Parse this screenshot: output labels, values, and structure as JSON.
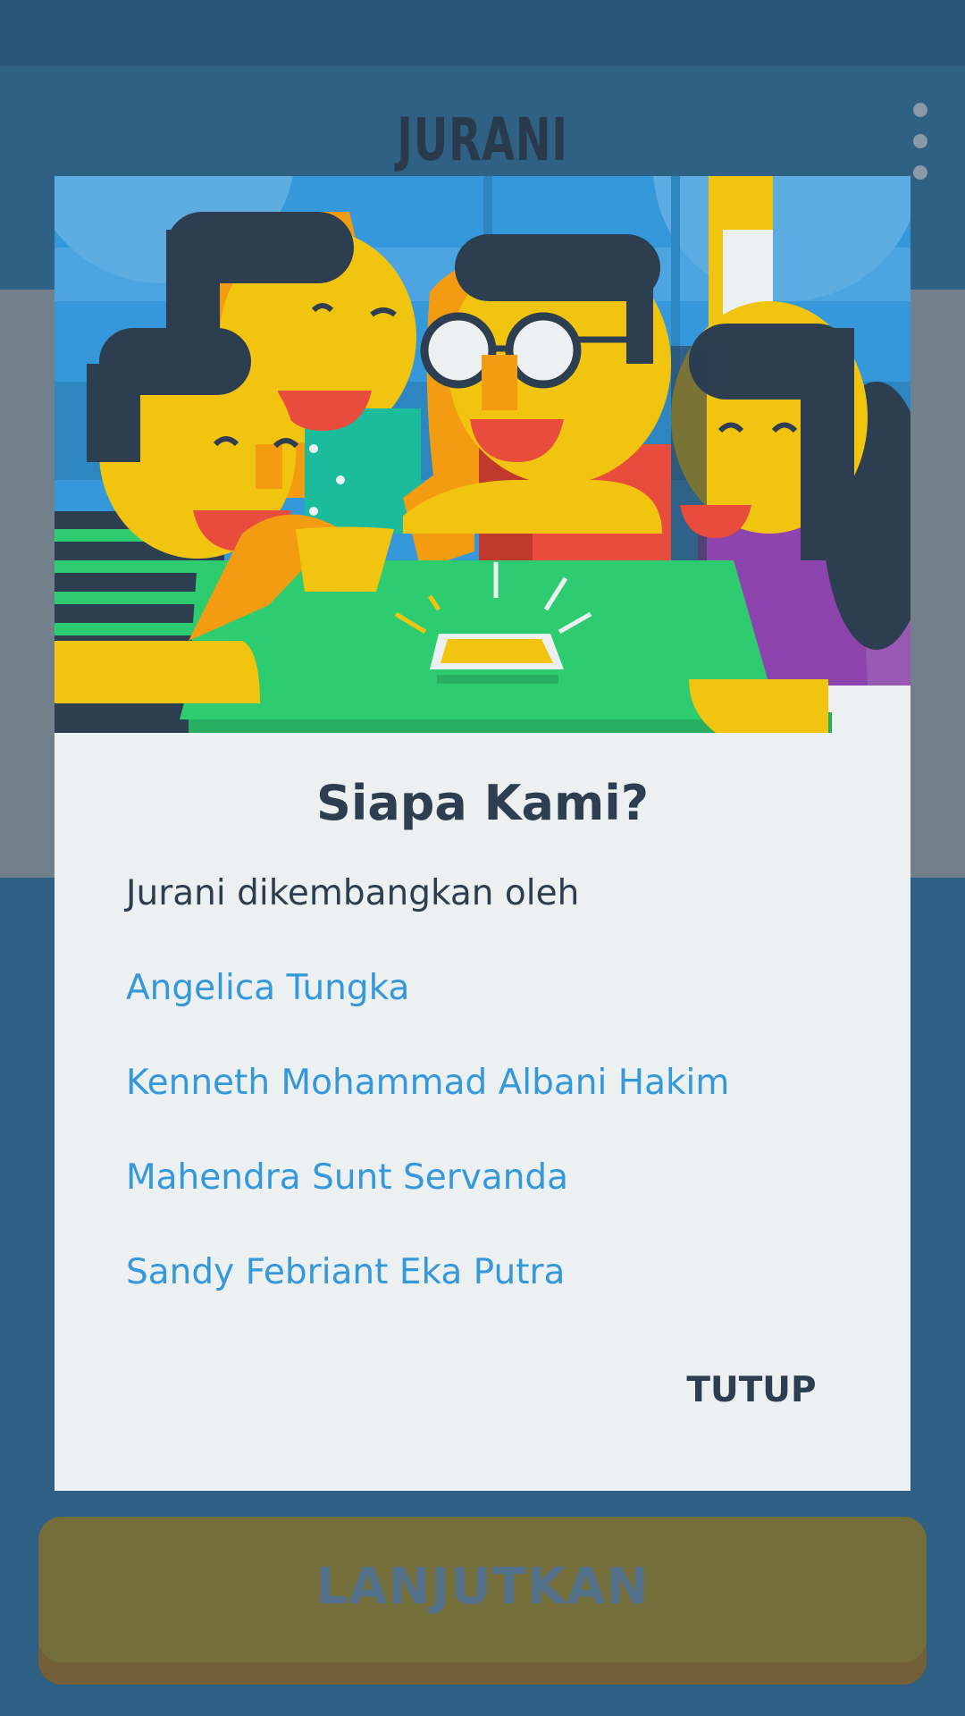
{
  "app": {
    "title": "JURANI",
    "menu_icon": "more-vert-icon"
  },
  "dialog": {
    "illustration": "group-of-friends-illustration",
    "title": "Siapa Kami?",
    "intro": "Jurani dikembangkan oleh",
    "developers": [
      "Angelica Tungka",
      "Kenneth Mohammad Albani Hakim",
      "Mahendra Sunt Servanda",
      "Sandy Febriant Eka Putra"
    ],
    "close_label": "TUTUP"
  },
  "footer": {
    "continue_label": "LANJUTKAN"
  },
  "colors": {
    "background": "#2e5f84",
    "dialog": "#ecf0f1",
    "title_text": "#2c3e50",
    "link": "#3498db",
    "continue_button": "#736e3a"
  }
}
